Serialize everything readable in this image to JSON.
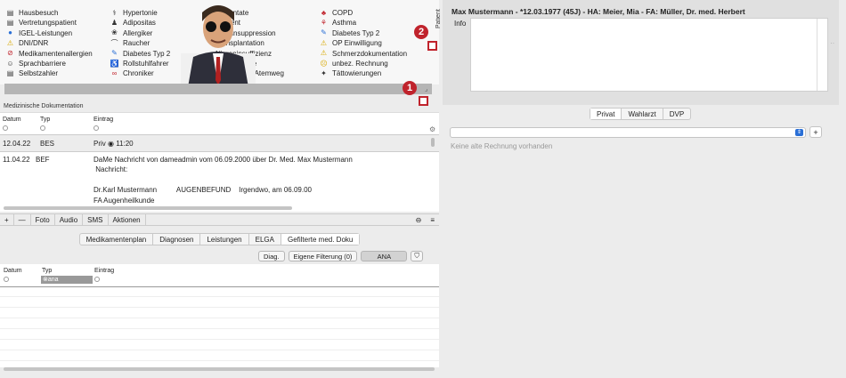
{
  "flags": {
    "col1": [
      {
        "icon": "document-icon",
        "label": "Hausbesuch"
      },
      {
        "icon": "document-icon",
        "label": "Vertretungspatient"
      },
      {
        "icon": "cap-icon",
        "label": "IGEL-Leistungen"
      },
      {
        "icon": "warning-icon",
        "label": "DNI/DNR"
      },
      {
        "icon": "no-icon",
        "label": "Medikamentenallergien"
      },
      {
        "icon": "speech-icon",
        "label": "Sprachbarriere"
      },
      {
        "icon": "document-icon",
        "label": "Selbstzahler"
      }
    ],
    "col2": [
      {
        "icon": "stethoscope-icon",
        "label": "Hypertonie"
      },
      {
        "icon": "person-icon",
        "label": "Adipositas"
      },
      {
        "icon": "allergy-icon",
        "label": "Allergiker"
      },
      {
        "icon": "pipe-icon",
        "label": "Raucher"
      },
      {
        "icon": "syringe-icon",
        "label": "Diabetes Typ 2"
      },
      {
        "icon": "wheelchair-icon",
        "label": "Rollstuhlfahrer"
      },
      {
        "icon": "chronic-icon",
        "label": "Chroniker"
      }
    ],
    "col3": [
      {
        "label": "Implantate"
      },
      {
        "label": "Dement"
      },
      {
        "label": "Immunsuppression"
      },
      {
        "label": "Transplantation"
      },
      {
        "label": "Niereninsuffizienz"
      },
      {
        "label": "Magensonde"
      },
      {
        "label": "Schwieriger Atemweg"
      }
    ],
    "col4": [
      {
        "icon": "lungs-icon",
        "label": "COPD"
      },
      {
        "icon": "asthma-icon",
        "label": "Asthma"
      },
      {
        "icon": "syringe-icon",
        "label": "Diabetes Typ 2"
      },
      {
        "icon": "warning-icon",
        "label": "OP Einwilligung"
      },
      {
        "icon": "warning-icon",
        "label": "Schmerzdokumentation"
      },
      {
        "icon": "smiley-icon",
        "label": "unbez. Rechnung"
      },
      {
        "icon": "tattoo-icon",
        "label": "Tättowierungen"
      }
    ]
  },
  "badges": {
    "one": "1",
    "two": "2"
  },
  "docs": {
    "title": "Medizinische Dokumentation",
    "headers": {
      "date": "Datum",
      "type": "Typ",
      "entry": "Eintrag"
    },
    "rows": [
      {
        "date": "12.04.22",
        "type": "BES",
        "entry": "Priv ◉ 11:20"
      },
      {
        "date": "11.04.22",
        "type": "BEF",
        "lines": [
          "DaMe Nachricht von dameadmin vom 06.09.2000 über Dr. Med. Max Mustermann",
          " Nachricht:",
          "",
          "Dr.Karl Mustermann          AUGENBEFUND    Irgendwo, am 06.09.00",
          "FA Augenheilkunde"
        ]
      }
    ]
  },
  "toolbar": {
    "plus": "+",
    "minus": "—",
    "foto": "Foto",
    "audio": "Audio",
    "sms": "SMS",
    "actions": "Aktionen"
  },
  "bottomTabs": [
    "Medikamentenplan",
    "Diagnosen",
    "Leistungen",
    "ELGA",
    "Gefilterte med. Doku"
  ],
  "filters": {
    "diag": "Diag.",
    "own": "Eigene Filterung (0)",
    "ana": "ANA"
  },
  "ftable": {
    "date": "Datum",
    "type": "Typ",
    "entry": "Eintrag",
    "typeFilter": "ana"
  },
  "patient": {
    "verticalLabel": "Patient",
    "header": "Max Mustermann - *12.03.1977 (45J) - HA: Meier, Mia - FA: Müller, Dr. med. Herbert",
    "info": "Info"
  },
  "billing": {
    "tabs": [
      "Privat",
      "Wahlarzt",
      "DVP"
    ],
    "plus": "+",
    "empty": "Keine alte Rechnung vorhanden"
  },
  "colors": {
    "badge": "#c0232c",
    "accent": "#2a6fd6"
  }
}
